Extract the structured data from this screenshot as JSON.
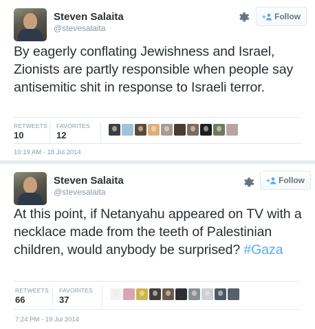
{
  "tweets": [
    {
      "author": {
        "name": "Steven Salaita",
        "handle": "@stevesalaita"
      },
      "follow_label": "Follow",
      "text": "By eagerly conflating Jewishness and Israel, Zionists are partly responsible when people say antisemitic shit in response to Israeli terror.",
      "stats": {
        "retweets_label": "RETWEETS",
        "retweets": "10",
        "favorites_label": "FAVORITES",
        "favorites": "12"
      },
      "favoriters_colors": [
        "#3a3f46",
        "#9fc3d8",
        "#5a4a3e",
        "#d9b07a",
        "#a89c92",
        "#4b3b33",
        "#7a6a60",
        "#1b1e22",
        "#6c7a5e",
        "#b8a5a2"
      ],
      "timestamp": "10:19 AM - 18 Jul 2014"
    },
    {
      "author": {
        "name": "Steven Salaita",
        "handle": "@stevesalaita"
      },
      "follow_label": "Follow",
      "text_before": "At this point, if Netanyahu appeared on TV with a necklace made from the teeth of Palestinian children, would anybody be surprised?",
      "hashtag": "#Gaza",
      "stats": {
        "retweets_label": "RETWEETS",
        "retweets": "66",
        "favorites_label": "FAVORITES",
        "favorites": "37"
      },
      "favoriters_colors": [
        "#f2f2f2",
        "#d9a6b0",
        "#c8b84a",
        "#3e3e3e",
        "#6b5a4c",
        "#2f2f33",
        "#8a8f96",
        "#c9d0d6",
        "#4d5a66",
        "#55606b"
      ],
      "timestamp": "7:24 PM - 19 Jul 2014"
    }
  ],
  "icons": {
    "settings": "gear-icon",
    "follow": "add-user-icon"
  }
}
